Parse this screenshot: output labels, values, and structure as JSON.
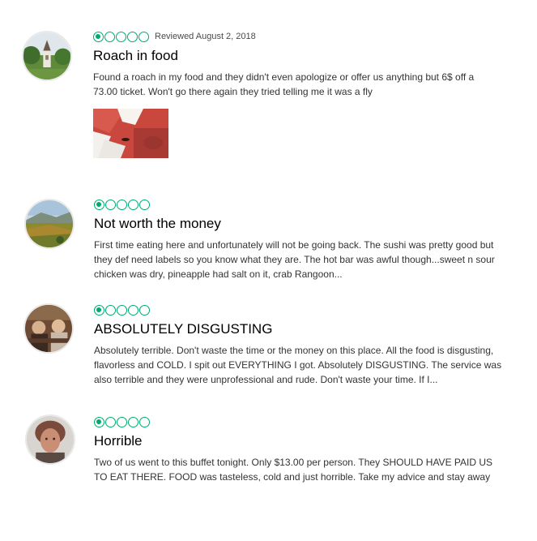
{
  "reviews": [
    {
      "rating": 1,
      "date": "Reviewed August 2, 2018",
      "title": "Roach in food",
      "text": "Found a roach in my food and they didn't even apologize or offer us anything but 6$ off a 73.00 ticket. Won't go there again they tried telling me it was a fly",
      "avatar_icon": "church-landscape-avatar",
      "has_photo": true
    },
    {
      "rating": 1,
      "title": "Not worth the money",
      "text": "First time eating here and unfortunately will not be going back. The sushi was pretty good but they def need labels so you know what they are. The hot bar was awful though...sweet n sour chicken was dry, pineapple had salt on it, crab Rangoon...",
      "avatar_icon": "valley-landscape-avatar"
    },
    {
      "rating": 1,
      "title": "ABSOLUTELY DISGUSTING",
      "text": "Absolutely terrible. Don't waste the time or the money on this place. All the food is disgusting, flavorless and COLD. I spit out EVERYTHING I got. Absolutely DISGUSTING. The service was also terrible and they were unprofessional and rude. Don't waste your time. If I...",
      "avatar_icon": "people-photo-avatar"
    },
    {
      "rating": 1,
      "title": "Horrible",
      "text": "Two of us went to this buffet tonight. Only $13.00 per person. They SHOULD HAVE PAID US TO EAT THERE. FOOD was tasteless, cold and just horrible. Take my advice and stay away",
      "avatar_icon": "portrait-avatar"
    }
  ],
  "colors": {
    "bubble": "#00aa6c"
  }
}
